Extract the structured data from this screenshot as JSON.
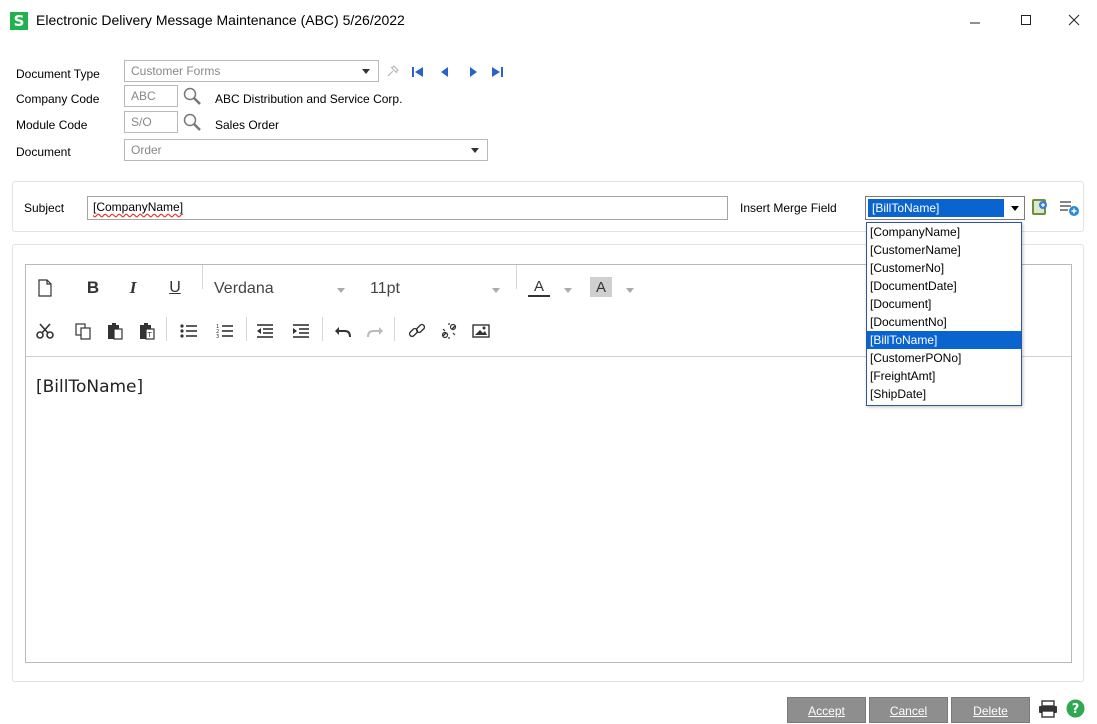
{
  "window": {
    "app_icon_letter": "S",
    "title": "Electronic Delivery Message Maintenance (ABC) 5/26/2022"
  },
  "header": {
    "document_type": {
      "label": "Document Type",
      "value": "Customer Forms"
    },
    "company_code": {
      "label": "Company Code",
      "value": "ABC",
      "description": "ABC Distribution and Service Corp."
    },
    "module_code": {
      "label": "Module Code",
      "value": "S/O",
      "description": "Sales Order"
    },
    "document": {
      "label": "Document",
      "value": "Order"
    }
  },
  "subject": {
    "label": "Subject",
    "value": "[CompanyName]"
  },
  "merge_field": {
    "label": "Insert Merge Field",
    "selected": "[BillToName]",
    "options": [
      "[CompanyName]",
      "[CustomerName]",
      "[CustomerNo]",
      "[DocumentDate]",
      "[Document]",
      "[DocumentNo]",
      "[BillToName]",
      "[CustomerPONo]",
      "[FreightAmt]",
      "[ShipDate]"
    ],
    "highlighted_index": 6
  },
  "editor": {
    "font": "Verdana",
    "size": "11pt",
    "bold_label": "B",
    "italic_label": "I",
    "underline_label": "U",
    "font_color_label": "A",
    "highlight_label": "A",
    "content": "[BillToName]"
  },
  "buttons": {
    "accept": "Accept",
    "cancel": "Cancel",
    "delete": "Delete"
  },
  "colors": {
    "selection": "#0a64d0",
    "button_bg": "#8e8e8e",
    "app_icon": "#22b14c",
    "help_icon": "#2fa84f"
  }
}
